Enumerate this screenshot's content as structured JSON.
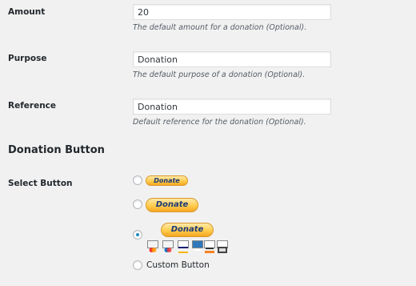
{
  "fields": {
    "amount": {
      "label": "Amount",
      "value": "20",
      "description": "The default amount for a donation (Optional)."
    },
    "purpose": {
      "label": "Purpose",
      "value": "Donation",
      "description": "The default purpose of a donation (Optional)."
    },
    "reference": {
      "label": "Reference",
      "value": "Donation",
      "description": "Default reference for the donation (Optional)."
    }
  },
  "donation_section": {
    "title": "Donation Button",
    "select_label": "Select Button",
    "options": [
      {
        "button_text": "Donate",
        "selected": false
      },
      {
        "button_text": "Donate",
        "selected": false
      },
      {
        "button_text": "Donate",
        "selected": true,
        "cards": [
          "mastercard-icon",
          "maestro-icon",
          "visa-icon",
          "amex-icon",
          "discover-icon",
          "bank-icon"
        ]
      },
      {
        "label": "Custom Button",
        "selected": false
      }
    ]
  },
  "colors": {
    "accent": "#1e8cbe",
    "paypal_yellow": "#ffcc4d",
    "paypal_text": "#1b3a7a"
  }
}
